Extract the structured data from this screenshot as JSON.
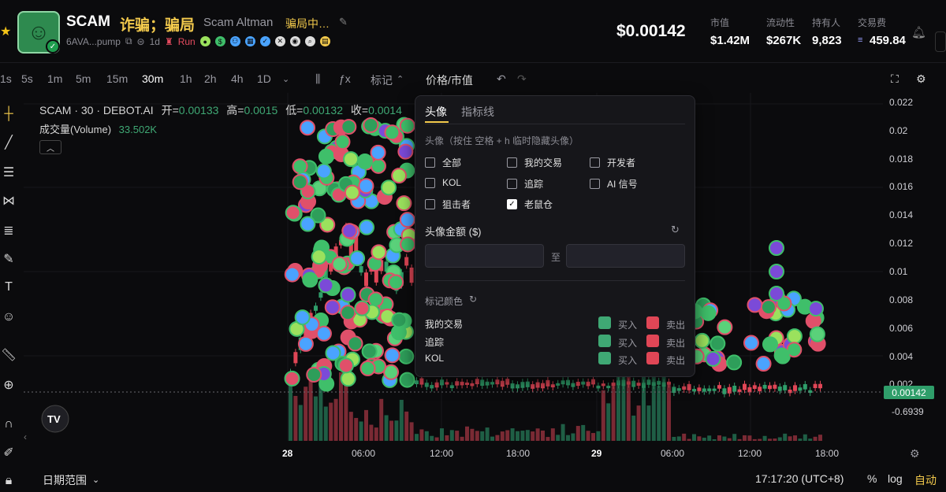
{
  "header": {
    "symbol": "SCAM",
    "cn_name": "诈骗；骗局",
    "full_name": "Scam Altman",
    "alias": "骗局中…",
    "address": "6AVA...pump",
    "age": "1d",
    "run_label": "Run",
    "price": "$0.00142",
    "stats": [
      {
        "label": "市值",
        "value": "$1.42M"
      },
      {
        "label": "流动性",
        "value": "$267K"
      },
      {
        "label": "持有人",
        "value": "9,823"
      },
      {
        "label": "交易费",
        "value": "459.84"
      }
    ]
  },
  "timeframes": [
    "1s",
    "5s",
    "1m",
    "5m",
    "15m",
    "30m",
    "1h",
    "2h",
    "4h",
    "1D"
  ],
  "active_timeframe": "30m",
  "toolbar": {
    "marks": "标记",
    "price_mcap": "价格/市值"
  },
  "legend": {
    "title": "SCAM · 30 · DEBOT.AI",
    "open_label": "开=",
    "open": "0.00133",
    "high_label": "高=",
    "high": "0.0015",
    "low_label": "低=",
    "low": "0.00132",
    "close_label": "收=",
    "close": "0.0014",
    "volume_label": "成交量(Volume)",
    "volume": "33.502K"
  },
  "yaxis": [
    "0.022",
    "0.02",
    "0.018",
    "0.016",
    "0.014",
    "0.012",
    "0.01",
    "0.008",
    "0.006",
    "0.004",
    "0.002",
    "-0.6939"
  ],
  "price_tag": "0.00142",
  "xaxis": [
    "28",
    "06:00",
    "12:00",
    "18:00",
    "29",
    "06:00",
    "12:00",
    "18:00"
  ],
  "bottom": {
    "date_range": "日期范围",
    "time": "17:17:20 (UTC+8)",
    "percent": "%",
    "log": "log",
    "auto": "自动"
  },
  "panel": {
    "tab_avatar": "头像",
    "tab_indicator": "指标线",
    "hint": "头像（按住 空格 + h 临时隐藏头像）",
    "checkboxes": [
      {
        "label": "全部",
        "checked": false
      },
      {
        "label": "我的交易",
        "checked": false
      },
      {
        "label": "开发者",
        "checked": false
      },
      {
        "label": "KOL",
        "checked": false
      },
      {
        "label": "追踪",
        "checked": false
      },
      {
        "label": "AI 信号",
        "checked": false
      },
      {
        "label": "狙击者",
        "checked": false
      },
      {
        "label": "老鼠仓",
        "checked": true
      }
    ],
    "amount_label": "头像金额 ($)",
    "to_label": "至",
    "min_value": "",
    "max_value": "",
    "color_label": "标记颜色",
    "color_rows": [
      {
        "label": "我的交易",
        "buy": "买入",
        "sell": "卖出"
      },
      {
        "label": "追踪",
        "buy": "买入",
        "sell": "卖出"
      },
      {
        "label": "KOL",
        "buy": "买入",
        "sell": "卖出"
      }
    ]
  },
  "colors": {
    "up": "#2f9e6a",
    "down": "#e04656",
    "accent": "#f2c94c"
  }
}
